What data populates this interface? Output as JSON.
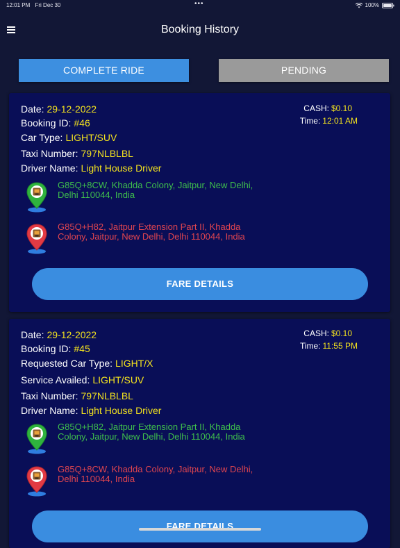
{
  "status_bar": {
    "time": "12:01 PM",
    "date": "Fri Dec 30",
    "dots": "•••",
    "battery": "100%"
  },
  "header": {
    "title": "Booking History"
  },
  "tabs": [
    {
      "label": "COMPLETE RIDE",
      "active": true
    },
    {
      "label": "PENDING",
      "active": false
    }
  ],
  "bookings": [
    {
      "date_label": "Date:",
      "date": "29-12-2022",
      "booking_id_label": "Booking ID:",
      "booking_id": "#46",
      "car_type_label": "Car Type:",
      "car_type": "LIGHT/SUV",
      "taxi_number_label": "Taxi Number:",
      "taxi_number": "797NLBLBL",
      "driver_name_label": "Driver Name:",
      "driver_name": "Light House Driver",
      "cash_label": "CASH:",
      "cash": "$0.10",
      "time_label": "Time:",
      "time": "12:01 AM",
      "pickup": "G85Q+8CW, Khadda Colony, Jaitpur, New Delhi, Delhi 110044, India",
      "dropoff": "G85Q+H82, Jaitpur Extension Part II, Khadda Colony, Jaitpur, New Delhi, Delhi 110044, India",
      "button_label": "FARE DETAILS"
    },
    {
      "date_label": "Date:",
      "date": "29-12-2022",
      "booking_id_label": "Booking ID:",
      "booking_id": "#45",
      "requested_car_type_label": "Requested Car Type:",
      "requested_car_type": "LIGHT/X",
      "service_availed_label": "Service Availed:",
      "service_availed": "LIGHT/SUV",
      "taxi_number_label": "Taxi Number:",
      "taxi_number": "797NLBLBL",
      "driver_name_label": "Driver Name:",
      "driver_name": "Light House Driver",
      "cash_label": "CASH:",
      "cash": "$0.10",
      "time_label": "Time:",
      "time": "11:55 PM",
      "pickup": "G85Q+H82, Jaitpur Extension Part II, Khadda Colony, Jaitpur, New Delhi, Delhi 110044, India",
      "dropoff": "G85Q+8CW, Khadda Colony, Jaitpur, New Delhi, Delhi 110044, India",
      "button_label": "FARE DETAILS"
    }
  ],
  "icons": {
    "menu": "hamburger-menu-icon",
    "pickup": "green-location-pin-icon",
    "dropoff": "red-location-pin-icon",
    "wifi": "wifi-icon",
    "battery": "battery-icon"
  },
  "colors": {
    "background": "#121736",
    "card": "#090e57",
    "accent_blue": "#3d8fe0",
    "pending_gray": "#9a9a9a",
    "value_yellow": "#f3e21e",
    "pickup_green": "#3fbf4c",
    "dropoff_red": "#e0454f"
  }
}
